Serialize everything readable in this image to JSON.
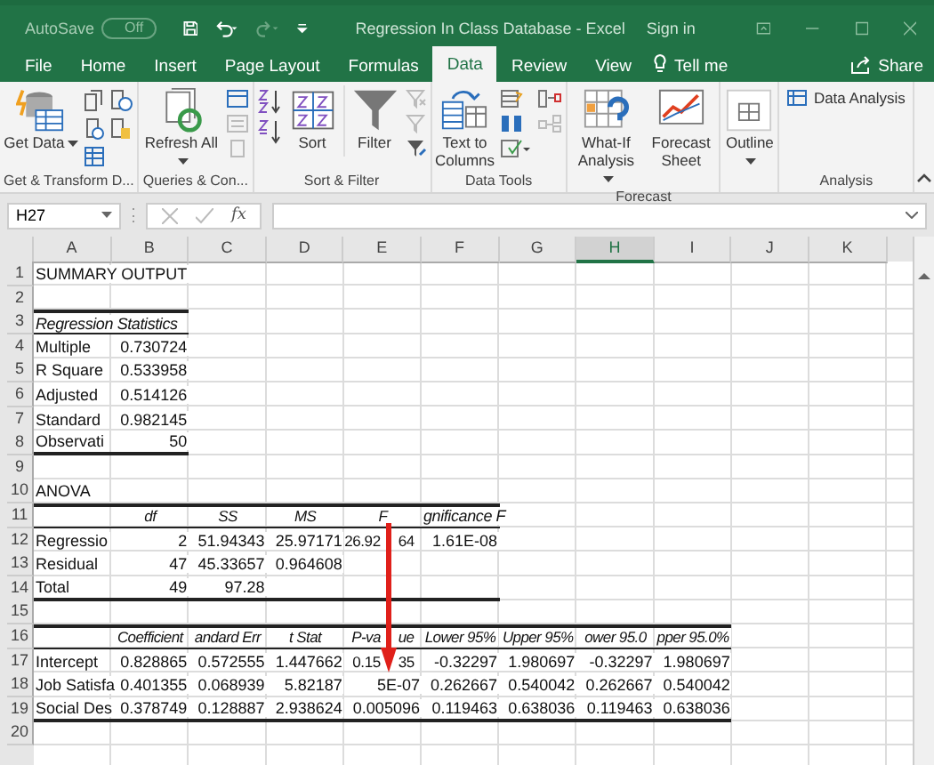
{
  "title_bar": {
    "autosave": "AutoSave",
    "autosave_state": "Off",
    "title": "Regression In Class Database  -  Excel",
    "sign_in": "Sign in"
  },
  "tabs": [
    {
      "label": "File",
      "selected": false
    },
    {
      "label": "Home",
      "selected": false
    },
    {
      "label": "Insert",
      "selected": false
    },
    {
      "label": "Page Layout",
      "selected": false
    },
    {
      "label": "Formulas",
      "selected": false
    },
    {
      "label": "Data",
      "selected": true
    },
    {
      "label": "Review",
      "selected": false
    },
    {
      "label": "View",
      "selected": false
    }
  ],
  "tell_me": "Tell me",
  "share": "Share",
  "ribbon": [
    {
      "kind": "get-transform",
      "label": "Get & Transform D...",
      "buttons": [
        {
          "label": "Get Data",
          "dropdown": true
        }
      ]
    },
    {
      "kind": "queries",
      "label": "Queries & Con...",
      "buttons": [
        {
          "label": "Refresh All",
          "dropdown": true
        }
      ]
    },
    {
      "kind": "sort-filter",
      "label": "Sort & Filter",
      "buttons": [
        {
          "label": "Sort",
          "dropdown": false
        },
        {
          "label": "Filter",
          "dropdown": false
        }
      ]
    },
    {
      "kind": "data-tools",
      "label": "Data Tools",
      "buttons": [
        {
          "label": "Text to Columns",
          "dropdown": false
        }
      ]
    },
    {
      "kind": "forecast",
      "label": "Forecast",
      "buttons": [
        {
          "label": "What-If Analysis",
          "dropdown": true
        },
        {
          "label": "Forecast Sheet",
          "dropdown": false
        }
      ]
    },
    {
      "kind": "outline",
      "buttons": [
        {
          "label": "Outline",
          "dropdown": true
        }
      ]
    },
    {
      "kind": "analysis",
      "label": "Analysis",
      "buttons": [
        {
          "label": "Data Analysis",
          "dropdown": false
        }
      ]
    }
  ],
  "name_box": "H27",
  "formula_icon": "fx",
  "columns": [
    {
      "label": "A",
      "selected": false
    },
    {
      "label": "B",
      "selected": false
    },
    {
      "label": "C",
      "selected": false
    },
    {
      "label": "D",
      "selected": false
    },
    {
      "label": "E",
      "selected": false
    },
    {
      "label": "F",
      "selected": false
    },
    {
      "label": "G",
      "selected": false
    },
    {
      "label": "H",
      "selected": true
    },
    {
      "label": "I",
      "selected": false
    },
    {
      "label": "J",
      "selected": false
    },
    {
      "label": "K",
      "selected": false
    }
  ],
  "rows": [
    {
      "number": "1",
      "cells": [
        {
          "text": "SUMMARY OUTPUT",
          "kind": "label"
        }
      ]
    },
    {
      "number": "2",
      "cells": []
    },
    {
      "number": "3",
      "thick_top": true,
      "thin_below": true,
      "cells": [
        {
          "text": "Regression Statistics",
          "kind": "italic"
        },
        {
          "kind": "blank"
        }
      ]
    },
    {
      "number": "4",
      "cells": [
        {
          "text": "Multiple",
          "kind": "label"
        },
        {
          "text": "0.730724",
          "kind": "number"
        }
      ]
    },
    {
      "number": "5",
      "cells": [
        {
          "text": "R Square",
          "kind": "label"
        },
        {
          "text": "0.533958",
          "kind": "number"
        }
      ]
    },
    {
      "number": "6",
      "cells": [
        {
          "text": "Adjusted",
          "kind": "label"
        },
        {
          "text": "0.514126",
          "kind": "number"
        }
      ]
    },
    {
      "number": "7",
      "cells": [
        {
          "text": "Standard",
          "kind": "label"
        },
        {
          "text": "0.982145",
          "kind": "number"
        }
      ]
    },
    {
      "number": "8",
      "thick_below": true,
      "cells": [
        {
          "text": "Observati",
          "kind": "label"
        },
        {
          "text": "50",
          "kind": "number"
        }
      ]
    },
    {
      "number": "9",
      "cells": []
    },
    {
      "number": "10",
      "cells": [
        {
          "text": "ANOVA",
          "kind": "label"
        }
      ]
    },
    {
      "number": "11",
      "thick_top": true,
      "thin_below": true,
      "cells": [
        {
          "kind": "blank"
        },
        {
          "text": "df",
          "kind": "heading"
        },
        {
          "text": "SS",
          "kind": "heading"
        },
        {
          "text": "MS",
          "kind": "heading"
        },
        {
          "text": "F",
          "kind": "heading"
        },
        {
          "text": "gnificance F",
          "kind": "italic"
        }
      ]
    },
    {
      "number": "12",
      "cells": [
        {
          "text": "Regressio",
          "kind": "label"
        },
        {
          "text": "2",
          "kind": "number"
        },
        {
          "text": "51.94343",
          "kind": "number"
        },
        {
          "text": "25.97171",
          "kind": "number"
        },
        {
          "parts": [
            "26.92",
            "64"
          ],
          "kind": "number"
        },
        {
          "text": "1.61E-08",
          "kind": "number"
        }
      ]
    },
    {
      "number": "13",
      "cells": [
        {
          "text": "Residual",
          "kind": "label"
        },
        {
          "text": "47",
          "kind": "number"
        },
        {
          "text": "45.33657",
          "kind": "number"
        },
        {
          "text": "0.964608",
          "kind": "number"
        }
      ]
    },
    {
      "number": "14",
      "thick_below": true,
      "cells": [
        {
          "text": "Total",
          "kind": "label"
        },
        {
          "text": "49",
          "kind": "number"
        },
        {
          "text": "97.28",
          "kind": "number"
        },
        {
          "kind": "blank"
        },
        {
          "kind": "blank"
        },
        {
          "kind": "blank"
        }
      ]
    },
    {
      "number": "15",
      "cells": []
    },
    {
      "number": "16",
      "thick_top": true,
      "thin_below": true,
      "cells": [
        {
          "kind": "blank"
        },
        {
          "text": "Coefficient",
          "kind": "heading"
        },
        {
          "text": "andard Err",
          "kind": "heading"
        },
        {
          "text": "t Stat",
          "kind": "heading"
        },
        {
          "parts": [
            "P-va",
            "ue"
          ],
          "kind": "heading"
        },
        {
          "text": "Lower 95%",
          "kind": "heading"
        },
        {
          "text": "Upper 95%",
          "kind": "heading"
        },
        {
          "text": "ower 95.0",
          "kind": "heading"
        },
        {
          "text": "pper 95.0%",
          "kind": "heading"
        }
      ]
    },
    {
      "number": "17",
      "cells": [
        {
          "text": "Intercept",
          "kind": "label"
        },
        {
          "text": "0.828865",
          "kind": "number"
        },
        {
          "text": "0.572555",
          "kind": "number"
        },
        {
          "text": "1.447662",
          "kind": "number"
        },
        {
          "parts": [
            "0.15",
            "35"
          ],
          "kind": "number"
        },
        {
          "text": "-0.32297",
          "kind": "number"
        },
        {
          "text": "1.980697",
          "kind": "number"
        },
        {
          "text": "-0.32297",
          "kind": "number"
        },
        {
          "text": "1.980697",
          "kind": "number"
        }
      ]
    },
    {
      "number": "18",
      "cells": [
        {
          "text": "Job Satisfa",
          "kind": "label"
        },
        {
          "text": "0.401355",
          "kind": "number"
        },
        {
          "text": "0.068939",
          "kind": "number"
        },
        {
          "text": "5.82187",
          "kind": "number"
        },
        {
          "text": "5E-07",
          "kind": "number"
        },
        {
          "text": "0.262667",
          "kind": "number"
        },
        {
          "text": "0.540042",
          "kind": "number"
        },
        {
          "text": "0.262667",
          "kind": "number"
        },
        {
          "text": "0.540042",
          "kind": "number"
        }
      ]
    },
    {
      "number": "19",
      "thick_below": true,
      "cells": [
        {
          "text": "Social Des",
          "kind": "label"
        },
        {
          "text": "0.378749",
          "kind": "number"
        },
        {
          "text": "0.128887",
          "kind": "number"
        },
        {
          "text": "2.938624",
          "kind": "number"
        },
        {
          "text": "0.005096",
          "kind": "number"
        },
        {
          "text": "0.119463",
          "kind": "number"
        },
        {
          "text": "0.638036",
          "kind": "number"
        },
        {
          "text": "0.119463",
          "kind": "number"
        },
        {
          "text": "0.638036",
          "kind": "number"
        }
      ]
    },
    {
      "number": "20",
      "cells": []
    }
  ]
}
